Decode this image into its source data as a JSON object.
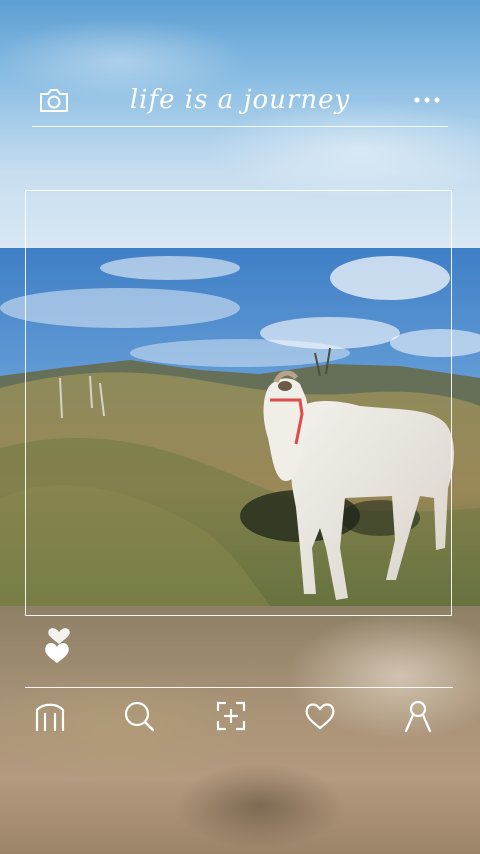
{
  "header": {
    "title": "life is a journey",
    "camera_icon": "camera-icon",
    "more_icon": "more-dots-icon"
  },
  "post": {
    "photo_description_icon": "photo",
    "like_icon": "double-heart-icon"
  },
  "nav": {
    "items": [
      {
        "icon": "home-icon"
      },
      {
        "icon": "search-icon"
      },
      {
        "icon": "add-post-icon"
      },
      {
        "icon": "heart-icon"
      },
      {
        "icon": "profile-icon"
      }
    ]
  },
  "colors": {
    "icon_stroke": "#ffffff",
    "sky_top": "#5d9fd3",
    "ground": "#8d8066"
  }
}
